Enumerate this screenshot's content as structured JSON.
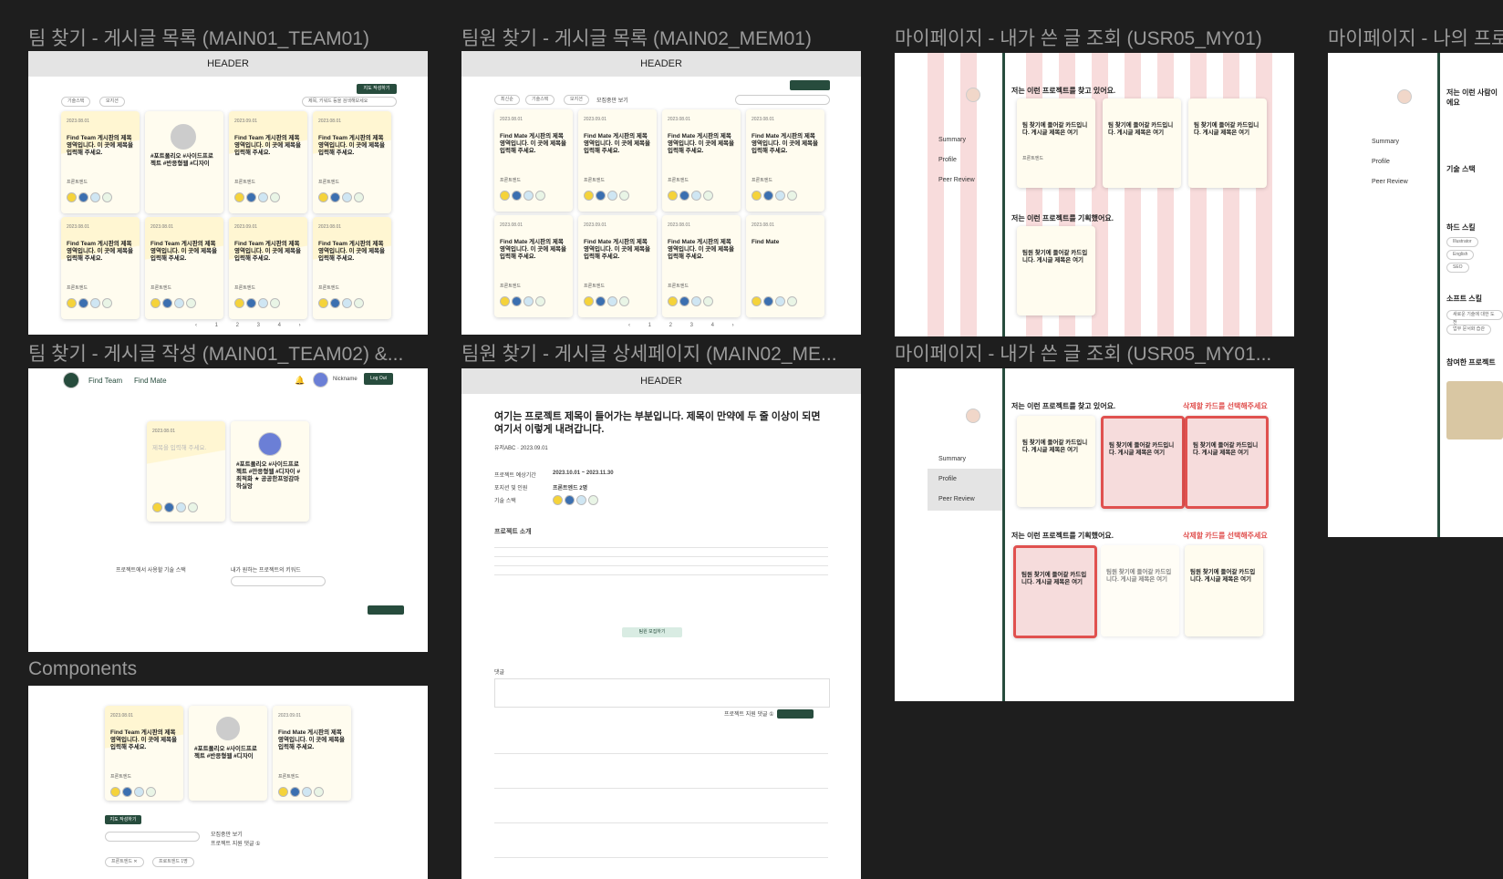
{
  "frames": {
    "f1": {
      "label": "팀 찾기 - 게시글 목록 (MAIN01_TEAM01)",
      "header": "HEADER",
      "write_btn": "지도 작성하기",
      "filters": [
        "기술스택",
        "모지션"
      ],
      "search": "제목, 키워드 등을 검색해보세요",
      "pages": "‹ 1 2 3 4 ›"
    },
    "f2": {
      "label": "팀원 찾기 - 게시글 목록 (MAIN02_MEM01)",
      "header": "HEADER",
      "filters": [
        "최신순",
        "기술스택",
        "모지션"
      ],
      "checkbox": "모집중만 보기",
      "pages": "‹ 1 2 3 4 ›"
    },
    "f3": {
      "label": "마이페이지 - 내가 쓴 글 조회 (USR05_MY01)",
      "sec1": "저는 이런 프로젝트를 찾고 있어요.",
      "sec2": "저는 이런 프로젝트를 기획했어요."
    },
    "f4": {
      "label": "마이페이지 - 나의 프로필",
      "intro": "저는 이런 사람이에요",
      "tech": "기술 스택",
      "hard": "하드 스킬",
      "soft": "소프트 스킬",
      "projects": "참여한 프로젝트",
      "hard_items": [
        "Illustrator",
        "English",
        "SEO"
      ],
      "soft_items": [
        "새로운 기술에 대한 도전",
        "업무 문서화 습관"
      ]
    },
    "f5": {
      "label": "팀 찾기 - 게시글 작성 (MAIN01_TEAM02) &...",
      "nav": [
        "Find Team",
        "Find Mate"
      ],
      "nickname": "Nickname",
      "logout": "Log Out",
      "placeholder": "제목을 입력해 주세요.",
      "tags": "#포트폴리오 #사이드프로젝트 #만응형웹 #디자이 #최적화 ★ 공공한프엉감마하실앙",
      "stack_label": "프로젝트에서 사용할 기술 스택",
      "keyword_label": "내가 원하는 프로젝트의 키워드"
    },
    "f6": {
      "label": "팀원 찾기 - 게시글 상세페이지 (MAIN02_ME...",
      "header": "HEADER",
      "title": "여기는 프로젝트 제목이 들어가는 부분입니다. 제목이 만약에 두 줄 이상이 되면 여기서 이렇게 내려갑니다.",
      "author": "유저ABC · 2023.09.01",
      "period_k": "프로젝트 예상기간",
      "period_v": "2023.10.01 ~ 2023.11.30",
      "role_k": "포지션 및 인원",
      "role_v": "프론트엔드 2명",
      "stack_k": "기술 스택",
      "intro_title": "프로젝트 소개",
      "apply_btn": "팀원 모집하기",
      "comments_title": "댓글",
      "comment_check": "프로젝트 지원 댓글 ①"
    },
    "f7": {
      "label": "마이페이지 - 내가 쓴 글 조회 (USR05_MY01...",
      "sec1": "저는 이런 프로젝트를 찾고 있어요.",
      "sec2": "저는 이런 프로젝트를 기획했어요.",
      "delete_hint": "삭제할 카드를 선택해주세요"
    },
    "f8": {
      "label": "Components",
      "write_btn": "지도 작성하기",
      "check1": "모집중만 보기",
      "check2": "프로젝트 지원 댓글 ①",
      "chips": [
        "프론트엔드 ✕",
        "프로트엔드 1명"
      ]
    }
  },
  "side_menu": [
    "Summary",
    "Profile",
    "Peer Review"
  ],
  "card": {
    "team_title": "Find Team 게시판의 제목 영역입니다. 이 곳에 제목을 입력해 주세요.",
    "mate_title": "Find Mate 게시판의 제목 영역입니다. 이 곳에 제목을 입력해 주세요.",
    "my_title": "팀 찾기에 들어갈 카드입니다. 게시글 제목은 여기",
    "plan_title": "팀원 찾기에 들어갈 카드입니다. 게시글 제목은 여기",
    "dates": [
      "2023.08.01",
      "2023.09.01",
      "2023.08.01",
      "2023.08.01"
    ],
    "position": "프론트엔드",
    "profile_tags": "#포트폴리오 #사이드프로젝트 #반응형웹 #디자이",
    "short_title": "Find Mate"
  },
  "colors": {
    "bg": "#1e1e1e",
    "green": "#274c3d",
    "cream": "#fffcef",
    "red": "#e0514f",
    "pink": "#f8dcdc"
  }
}
